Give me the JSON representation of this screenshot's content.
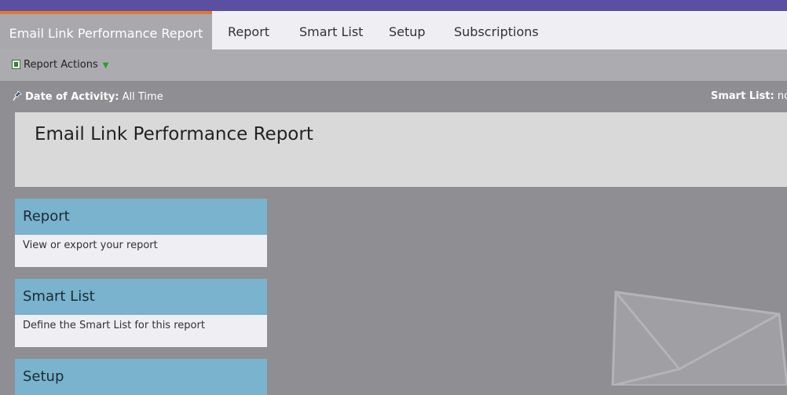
{
  "tabs": {
    "active": "Email Link Performance Report",
    "items": [
      "Report",
      "Smart List",
      "Setup",
      "Subscriptions"
    ]
  },
  "actions": {
    "report_actions_label": "Report Actions"
  },
  "filters": {
    "date_label": "Date of Activity:",
    "date_value": "All Time",
    "smart_list_label": "Smart List:",
    "smart_list_value": "no r"
  },
  "page_title": "Email Link Performance Report",
  "cards": [
    {
      "title": "Report",
      "desc": "View or export your report"
    },
    {
      "title": "Smart List",
      "desc": "Define the Smart List for this report"
    },
    {
      "title": "Setup",
      "desc": ""
    }
  ],
  "colors": {
    "top_bar": "#5a4fa0",
    "active_tab_accent": "#e07a2c",
    "card_header": "#79b3cd"
  }
}
